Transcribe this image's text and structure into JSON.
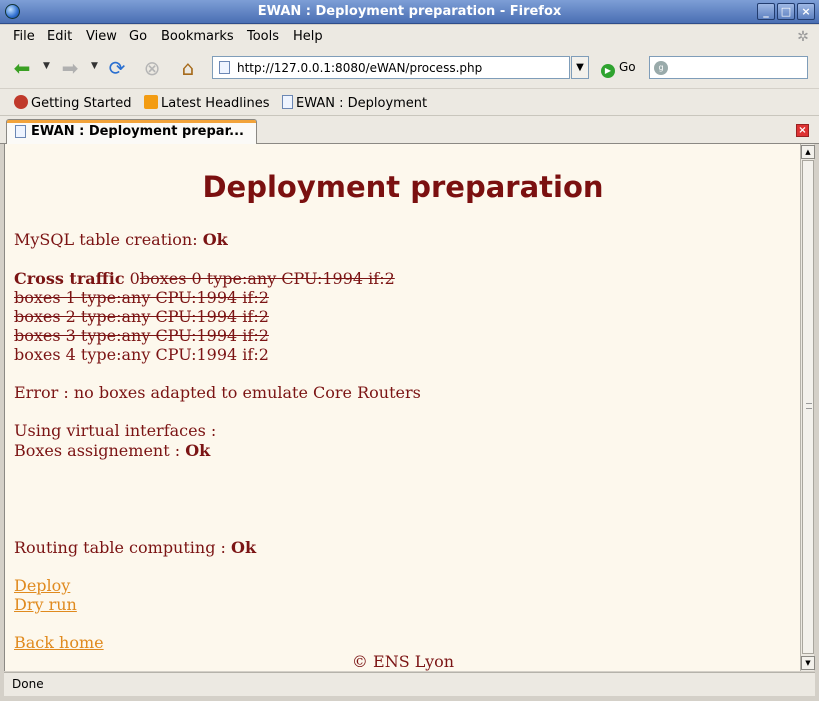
{
  "window": {
    "title": "EWAN : Deployment preparation - Firefox",
    "controls": [
      "_",
      "□",
      "×"
    ]
  },
  "menu": {
    "file": "File",
    "edit": "Edit",
    "view": "View",
    "go": "Go",
    "bookmarks": "Bookmarks",
    "tools": "Tools",
    "help": "Help"
  },
  "nav": {
    "url": "http://127.0.0.1:8080/eWAN/process.php",
    "go_label": "Go",
    "search_placeholder": ""
  },
  "bookmarks": [
    {
      "label": "Getting Started",
      "icon": "firefox-icon"
    },
    {
      "label": "Latest Headlines",
      "icon": "rss-icon"
    },
    {
      "label": "EWAN : Deployment",
      "icon": "page-icon"
    }
  ],
  "tab": {
    "label": "EWAN : Deployment prepar..."
  },
  "page": {
    "title": "Deployment preparation",
    "mysql_label": "MySQL table creation:",
    "mysql_status": "Ok",
    "cross_traffic_label": "Cross traffic",
    "cross_traffic_count": "0",
    "boxes": [
      {
        "text": "boxes 0 type:any CPU:1994 if:2",
        "struck": true
      },
      {
        "text": "boxes 1 type:any CPU:1994 if:2",
        "struck": true
      },
      {
        "text": "boxes 2 type:any CPU:1994 if:2",
        "struck": true
      },
      {
        "text": "boxes 3 type:any CPU:1994 if:2",
        "struck": true
      },
      {
        "text": "boxes 4 type:any CPU:1994 if:2",
        "struck": false
      }
    ],
    "error": "Error : no boxes adapted to emulate Core Routers",
    "virtual_interfaces": "Using virtual interfaces :",
    "boxes_assign_label": "Boxes assignement :",
    "boxes_assign_status": "Ok",
    "routing_label": "Routing table computing :",
    "routing_status": "Ok",
    "links": {
      "deploy": "Deploy",
      "dry_run": "Dry run",
      "back_home": "Back home"
    },
    "footer": "© ENS Lyon"
  },
  "status": {
    "text": "Done"
  },
  "colors": {
    "text": "#7b1414",
    "link": "#e08a1e",
    "background": "#fdf8ed"
  }
}
